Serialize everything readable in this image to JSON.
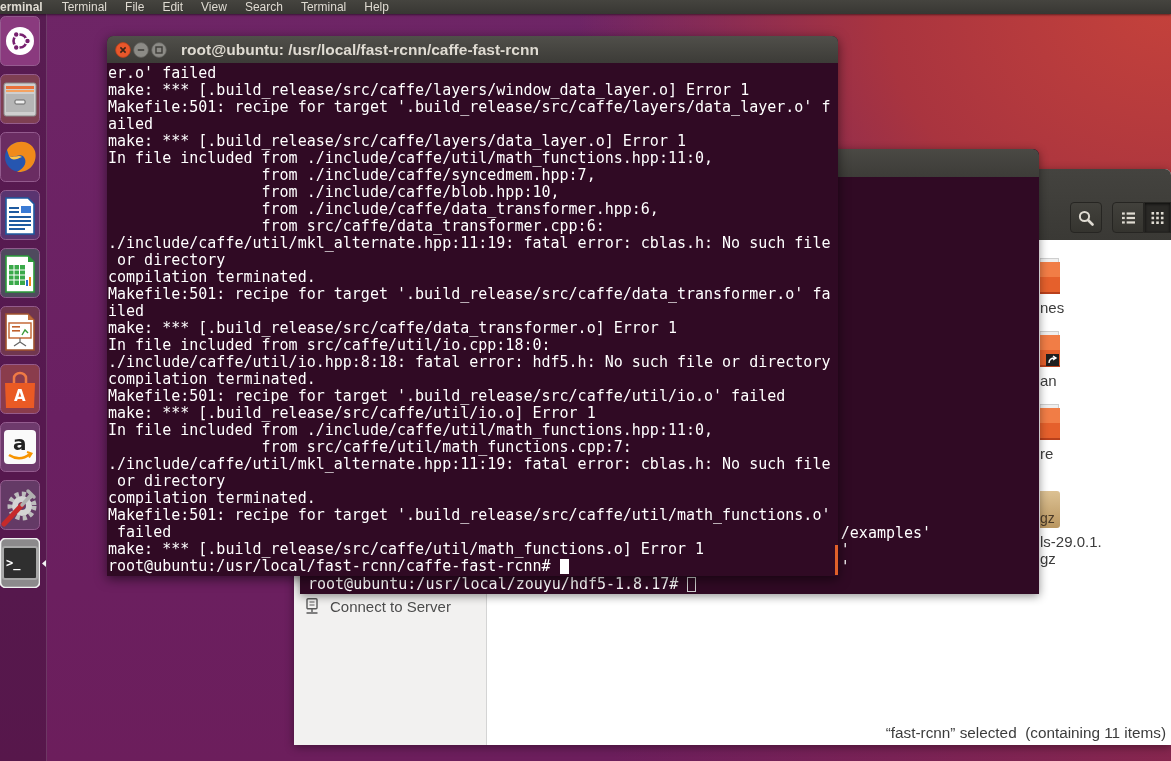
{
  "top_panel": {
    "app_title": "erminal",
    "menus": [
      "Terminal",
      "File",
      "Edit",
      "View",
      "Search",
      "Terminal",
      "Help"
    ]
  },
  "launcher": [
    {
      "kind": "dash",
      "selected": false
    },
    {
      "kind": "files",
      "selected": false
    },
    {
      "kind": "browser",
      "selected": false
    },
    {
      "kind": "writer",
      "selected": false
    },
    {
      "kind": "calc",
      "selected": false
    },
    {
      "kind": "impress",
      "selected": false
    },
    {
      "kind": "software",
      "glyph": "A",
      "selected": false
    },
    {
      "kind": "store",
      "glyph": "a",
      "selected": false
    },
    {
      "kind": "settings",
      "selected": false
    },
    {
      "kind": "terminal",
      "glyph": ">_",
      "selected": true
    }
  ],
  "terminal": {
    "title": "root@ubuntu: /usr/local/fast-rcnn/caffe-fast-rcnn",
    "focused": true,
    "lines": [
      "er.o' failed",
      "make: *** [.build_release/src/caffe/layers/window_data_layer.o] Error 1",
      "Makefile:501: recipe for target '.build_release/src/caffe/layers/data_layer.o' f",
      "ailed",
      "make: *** [.build_release/src/caffe/layers/data_layer.o] Error 1",
      "In file included from ./include/caffe/util/math_functions.hpp:11:0,",
      "                 from ./include/caffe/syncedmem.hpp:7,",
      "                 from ./include/caffe/blob.hpp:10,",
      "                 from ./include/caffe/data_transformer.hpp:6,",
      "                 from src/caffe/data_transformer.cpp:6:",
      "./include/caffe/util/mkl_alternate.hpp:11:19: fatal error: cblas.h: No such file",
      " or directory",
      "compilation terminated.",
      "Makefile:501: recipe for target '.build_release/src/caffe/data_transformer.o' fa",
      "iled",
      "make: *** [.build_release/src/caffe/data_transformer.o] Error 1",
      "In file included from src/caffe/util/io.cpp:18:0:",
      "./include/caffe/util/io.hpp:8:18: fatal error: hdf5.h: No such file or directory",
      "compilation terminated.",
      "Makefile:501: recipe for target '.build_release/src/caffe/util/io.o' failed",
      "make: *** [.build_release/src/caffe/util/io.o] Error 1",
      "In file included from ./include/caffe/util/math_functions.hpp:11:0,",
      "                 from src/caffe/util/math_functions.cpp:7:",
      "./include/caffe/util/mkl_alternate.hpp:11:19: fatal error: cblas.h: No such file",
      " or directory",
      "compilation terminated.",
      "Makefile:501: recipe for target '.build_release/src/caffe/util/math_functions.o'",
      " failed",
      "make: *** [.build_release/src/caffe/util/math_functions.o] Error 1"
    ],
    "prompt": "root@ubuntu:/usr/local/fast-rcnn/caffe-fast-rcnn#"
  },
  "back_terminal": {
    "focused": false,
    "lines": [
      "/examples'",
      "'",
      "'"
    ],
    "prompt": "root@ubuntu:/usr/local/zouyu/hdf5-1.8.17#"
  },
  "file_manager": {
    "view_buttons": [
      {
        "kind": "list",
        "selected": false
      },
      {
        "kind": "grid",
        "selected": true
      }
    ],
    "sidebar": [
      {
        "kind": "server",
        "label": "Connect to Server"
      }
    ],
    "files": [
      {
        "kind": "folder",
        "label": [
          "nes"
        ]
      },
      {
        "kind": "folder_link",
        "label": [
          "an"
        ]
      },
      {
        "kind": "folder",
        "label": [
          "re"
        ]
      },
      {
        "kind": "archive",
        "icon_text": "gz",
        "label": [
          "ls-29.0.1.",
          "gz"
        ]
      }
    ],
    "status": "“fast-rcnn” selected  (containing 11 items)"
  }
}
